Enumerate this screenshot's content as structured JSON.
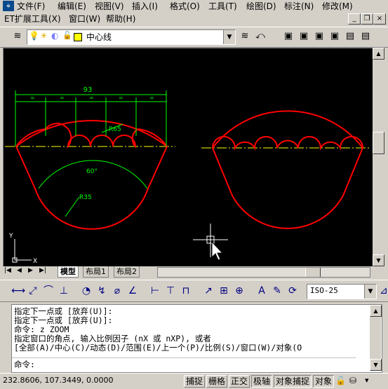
{
  "menu": {
    "items": [
      "文件(F)",
      "编辑(E)",
      "视图(V)",
      "插入(I)",
      "格式(O)",
      "工具(T)",
      "绘图(D)",
      "标注(N)",
      "修改(M)"
    ],
    "items2": [
      "ET扩展工具(X)",
      "窗口(W)",
      "帮助(H)"
    ]
  },
  "window_controls": {
    "minimize": "_",
    "restore": "❐",
    "close": "×"
  },
  "layer": {
    "current": "中心线"
  },
  "drawing": {
    "dim_width": "93",
    "dim_r65": "R65",
    "dim_angle": "60°",
    "dim_r35": "R35",
    "ucs_x": "X",
    "ucs_y": "Y"
  },
  "tabs": [
    "模型",
    "布局1",
    "布局2"
  ],
  "dim_style": {
    "value": "ISO-25"
  },
  "command": {
    "history": [
      "指定下一点或 [放弃(U)]:",
      "指定下一点或 [放弃(U)]:",
      "命令: z ZOOM",
      "指定窗口的角点, 输入比例因子 (nX 或 nXP), 或者",
      "[全部(A)/中心(C)/动态(D)/范围(E)/上一个(P)/比例(S)/窗口(W)/对象(O"
    ],
    "prompt": "命令:"
  },
  "status": {
    "coords": "232.8606, 107.3449, 0.0000",
    "buttons": [
      "捕捉",
      "栅格",
      "正交",
      "极轴",
      "对象捕捉",
      "对象"
    ]
  },
  "colors": {
    "red": "#ff0000",
    "green": "#00ff00",
    "yellow": "#ffff00",
    "background": "#000000"
  }
}
